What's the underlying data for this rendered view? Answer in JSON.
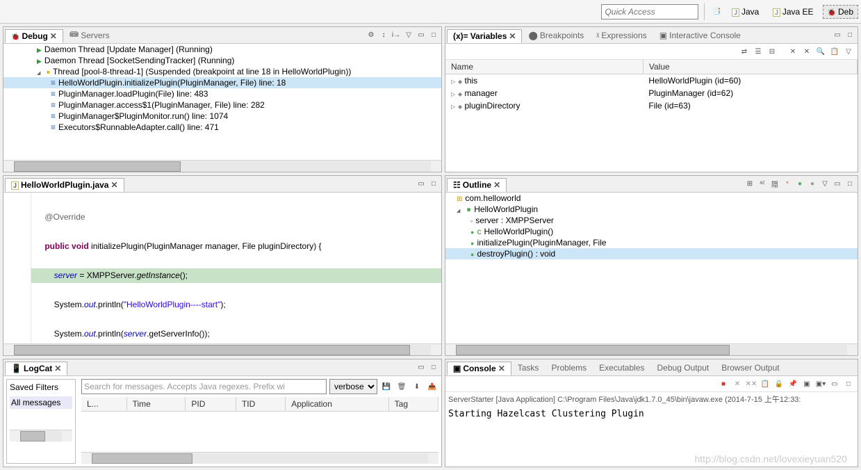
{
  "toolbar": {
    "quick_access_placeholder": "Quick Access",
    "perspectives": [
      "Java",
      "Java EE",
      "Deb"
    ]
  },
  "debug": {
    "tab": "Debug",
    "servers_tab": "Servers",
    "items": [
      {
        "indent": 1,
        "icon": "daemon",
        "label": "Daemon Thread [Update Manager] (Running)"
      },
      {
        "indent": 1,
        "icon": "daemon",
        "label": "Daemon Thread [SocketSendingTracker] (Running)"
      },
      {
        "indent": 1,
        "icon": "thread",
        "exp": "col",
        "label": "Thread [pool-8-thread-1] (Suspended (breakpoint at line 18 in HelloWorldPlugin))"
      },
      {
        "indent": 2,
        "icon": "stack",
        "sel": true,
        "label": "HelloWorldPlugin.initializePlugin(PluginManager, File) line: 18"
      },
      {
        "indent": 2,
        "icon": "stack",
        "label": "PluginManager.loadPlugin(File) line: 483"
      },
      {
        "indent": 2,
        "icon": "stack",
        "label": "PluginManager.access$1(PluginManager, File) line: 282"
      },
      {
        "indent": 2,
        "icon": "stack",
        "label": "PluginManager$PluginMonitor.run() line: 1074"
      },
      {
        "indent": 2,
        "icon": "stack",
        "label": "Executors$RunnableAdapter<T>.call() line: 471"
      }
    ]
  },
  "variables": {
    "tab": "Variables",
    "other_tabs": [
      "Breakpoints",
      "Expressions",
      "Interactive Console"
    ],
    "cols": [
      "Name",
      "Value"
    ],
    "rows": [
      {
        "name": "this",
        "value": "HelloWorldPlugin  (id=60)"
      },
      {
        "name": "manager",
        "value": "PluginManager  (id=62)"
      },
      {
        "name": "pluginDirectory",
        "value": "File  (id=63)"
      }
    ]
  },
  "editor": {
    "filename": "HelloWorldPlugin.java"
  },
  "outline": {
    "tab": "Outline",
    "items": [
      {
        "indent": 0,
        "icon": "pkg",
        "label": "com.helloworld"
      },
      {
        "indent": 0,
        "icon": "class",
        "exp": "col",
        "label": "HelloWorldPlugin"
      },
      {
        "indent": 1,
        "icon": "field",
        "label": "server : XMPPServer"
      },
      {
        "indent": 1,
        "icon": "method",
        "sup": "c",
        "label": "HelloWorldPlugin()"
      },
      {
        "indent": 1,
        "icon": "method",
        "label": "initializePlugin(PluginManager, File"
      },
      {
        "indent": 1,
        "icon": "method",
        "sel": true,
        "label": "destroyPlugin() : void"
      }
    ]
  },
  "logcat": {
    "tab": "LogCat",
    "saved_filters": "Saved Filters",
    "all_msgs": "All messages",
    "search_placeholder": "Search for messages. Accepts Java regexes. Prefix wi",
    "level": "verbose",
    "cols": [
      "L...",
      "Time",
      "PID",
      "TID",
      "Application",
      "Tag"
    ]
  },
  "console": {
    "tab": "Console",
    "other_tabs": [
      "Tasks",
      "Problems",
      "Executables",
      "Debug Output",
      "Browser Output"
    ],
    "header": "ServerStarter [Java Application] C:\\Program Files\\Java\\jdk1.7.0_45\\bin\\javaw.exe (2014-7-15 上午12:33:",
    "output": "Starting Hazelcast Clustering Plugin"
  },
  "watermark": "http://blog.csdn.net/lovexieyuan520"
}
